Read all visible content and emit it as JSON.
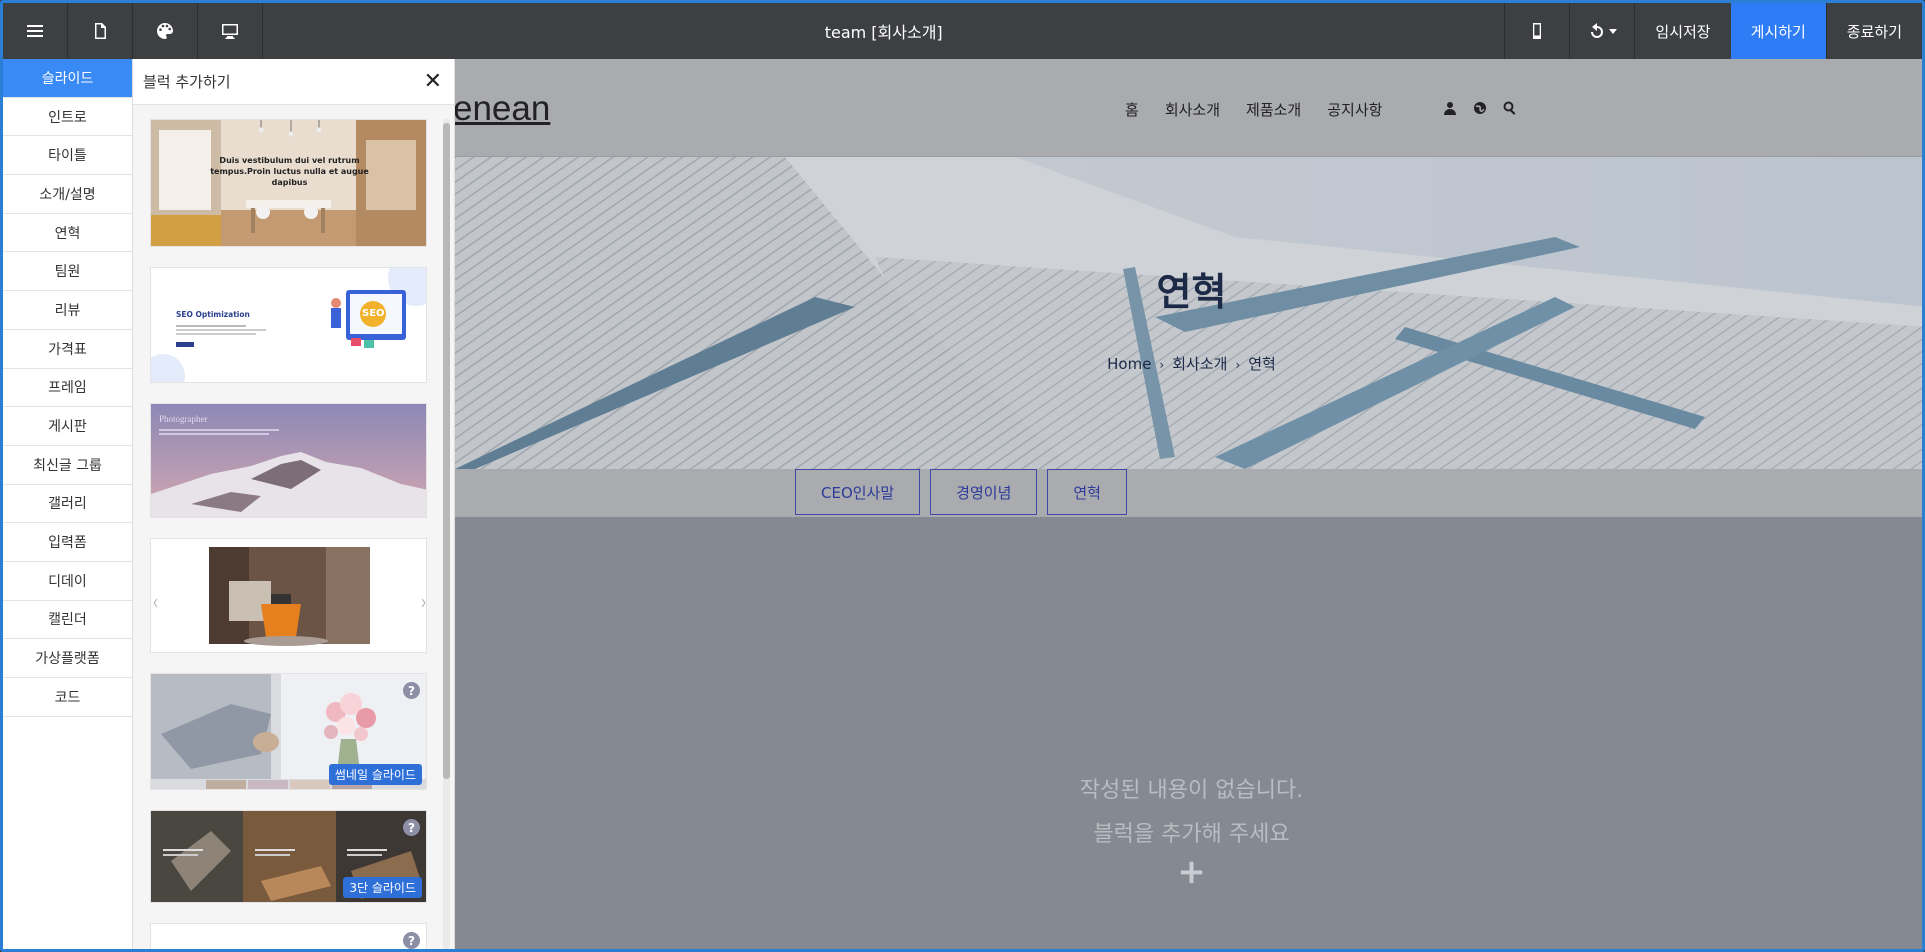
{
  "topbar": {
    "title": "team [회사소개]",
    "temp_save": "임시저장",
    "publish": "게시하기",
    "exit": "종료하기",
    "icons": [
      "menu-icon",
      "page-icon",
      "palette-icon",
      "desktop-icon",
      "mobile-icon",
      "undo-icon"
    ]
  },
  "categories": [
    "슬라이드",
    "인트로",
    "타이틀",
    "소개/설명",
    "연혁",
    "팀원",
    "리뷰",
    "가격표",
    "프레임",
    "게시판",
    "최신글 그룹",
    "갤러리",
    "입력폼",
    "디데이",
    "캘린더",
    "가상플랫폼",
    "코드"
  ],
  "panel": {
    "title": "블럭 추가하기",
    "thumbs": {
      "t1_heading": "Duis vestibulum dui vel rutrum tempus.Proin luctus nulla et augue dapibus",
      "t2_heading": "SEO Optimization",
      "t2_badge": "SEO",
      "t3_heading": "Photographer",
      "badge5": "썸네일 슬라이드",
      "badge6": "3단 슬라이드",
      "help": "?"
    }
  },
  "site": {
    "logo": "enean",
    "nav": [
      "홈",
      "회사소개",
      "제품소개",
      "공지사항"
    ],
    "hero_title": "연혁",
    "breadcrumb": [
      "Home",
      "회사소개",
      "연혁"
    ],
    "breadcrumb_sep": "›",
    "tabs": [
      "CEO인사말",
      "경영이념",
      "연혁"
    ],
    "empty_line1": "작성된 내용이 없습니다.",
    "empty_line2": "블럭을 추가해 주세요",
    "add": "+"
  }
}
